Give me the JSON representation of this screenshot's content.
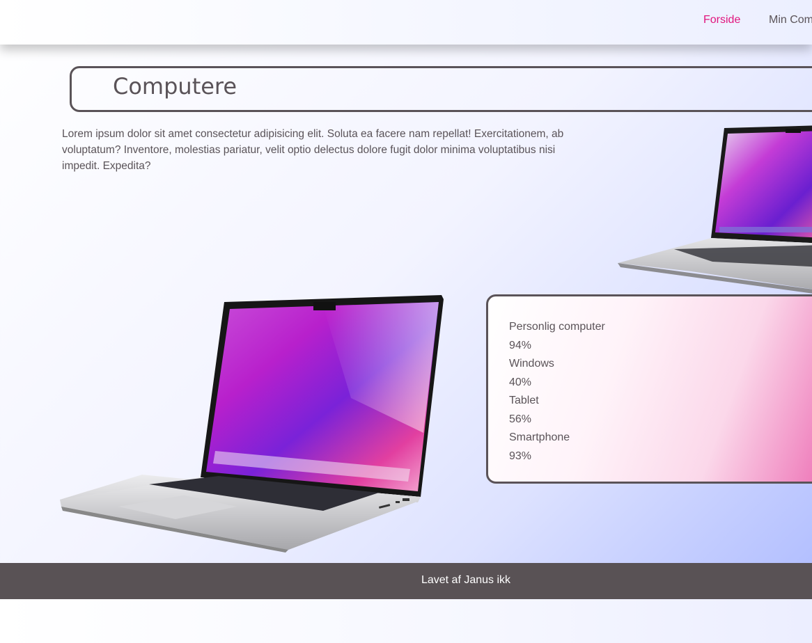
{
  "nav": {
    "links": [
      {
        "label": "Forside",
        "active": true
      },
      {
        "label": "Min Com",
        "active": false
      }
    ],
    "active_color": "#e0157e"
  },
  "main": {
    "title": "Computere",
    "intro": "Lorem ipsum dolor sit amet consectetur adipisicing elit. Soluta ea facere nam repellat! Exercitationem, ab voluptatum? Inventore, molestias pariatur, velit optio delectus dolore fugit dolor minima voluptatibus nisi impedit. Expedita?"
  },
  "stats": [
    {
      "label": "Personlig computer",
      "value": "94%"
    },
    {
      "label": "Windows",
      "value": "40%"
    },
    {
      "label": "Tablet",
      "value": "56%"
    },
    {
      "label": "Smartphone",
      "value": "93%"
    }
  ],
  "images": {
    "large": "laptop-image",
    "small": "laptop-image"
  },
  "footer": {
    "text": "Lavet af Janus ikk"
  }
}
